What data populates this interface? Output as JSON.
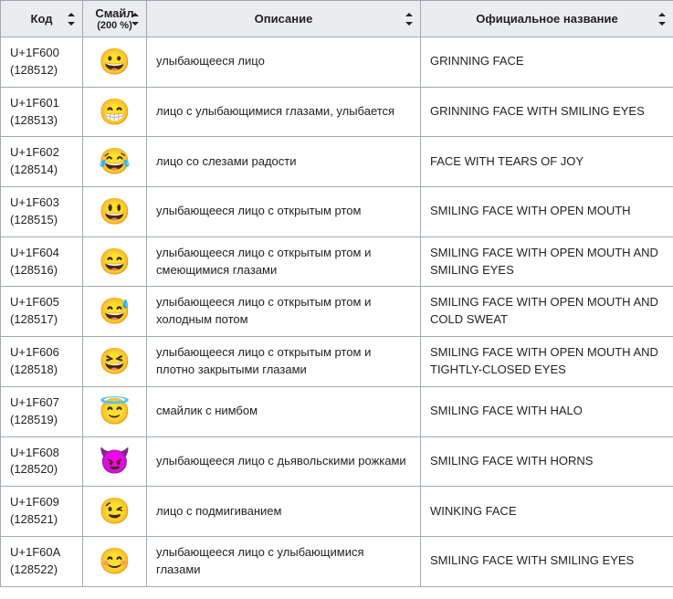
{
  "headers": {
    "code": "Код",
    "emoji_main": "Смайл",
    "emoji_sub": "(200 %)",
    "description": "Описание",
    "official": "Официальное название"
  },
  "rows": [
    {
      "code": "U+1F600",
      "decimal": "(128512)",
      "emoji": "😀",
      "description": "улыбающееся лицо",
      "official": "GRINNING FACE"
    },
    {
      "code": "U+1F601",
      "decimal": "(128513)",
      "emoji": "😁",
      "description": "лицо с улыбающимися глазами, улыбается",
      "official": "GRINNING FACE WITH SMILING EYES"
    },
    {
      "code": "U+1F602",
      "decimal": "(128514)",
      "emoji": "😂",
      "description": "лицо со слезами радости",
      "official": "FACE WITH TEARS OF JOY"
    },
    {
      "code": "U+1F603",
      "decimal": "(128515)",
      "emoji": "😃",
      "description": "улыбающееся лицо с открытым ртом",
      "official": "SMILING FACE WITH OPEN MOUTH"
    },
    {
      "code": "U+1F604",
      "decimal": "(128516)",
      "emoji": "😄",
      "description": "улыбающееся лицо с открытым ртом и смеющимися глазами",
      "official": "SMILING FACE WITH OPEN MOUTH AND SMILING EYES"
    },
    {
      "code": "U+1F605",
      "decimal": "(128517)",
      "emoji": "😅",
      "description": "улыбающееся лицо с открытым ртом и холодным потом",
      "official": "SMILING FACE WITH OPEN MOUTH AND COLD SWEAT"
    },
    {
      "code": "U+1F606",
      "decimal": "(128518)",
      "emoji": "😆",
      "description": "улыбающееся лицо с открытым ртом и плотно закрытыми глазами",
      "official": "SMILING FACE WITH OPEN MOUTH AND TIGHTLY-CLOSED EYES"
    },
    {
      "code": "U+1F607",
      "decimal": "(128519)",
      "emoji": "😇",
      "description": "смайлик с нимбом",
      "official": "SMILING FACE WITH HALO"
    },
    {
      "code": "U+1F608",
      "decimal": "(128520)",
      "emoji": "😈",
      "description": "улыбающееся лицо с дьявольскими рожками",
      "official": "SMILING FACE WITH HORNS"
    },
    {
      "code": "U+1F609",
      "decimal": "(128521)",
      "emoji": "😉",
      "description": "лицо с подмигиванием",
      "official": "WINKING FACE"
    },
    {
      "code": "U+1F60A",
      "decimal": "(128522)",
      "emoji": "😊",
      "description": "улыбающееся лицо с улыбающимися глазами",
      "official": "SMILING FACE WITH SMILING EYES"
    }
  ]
}
